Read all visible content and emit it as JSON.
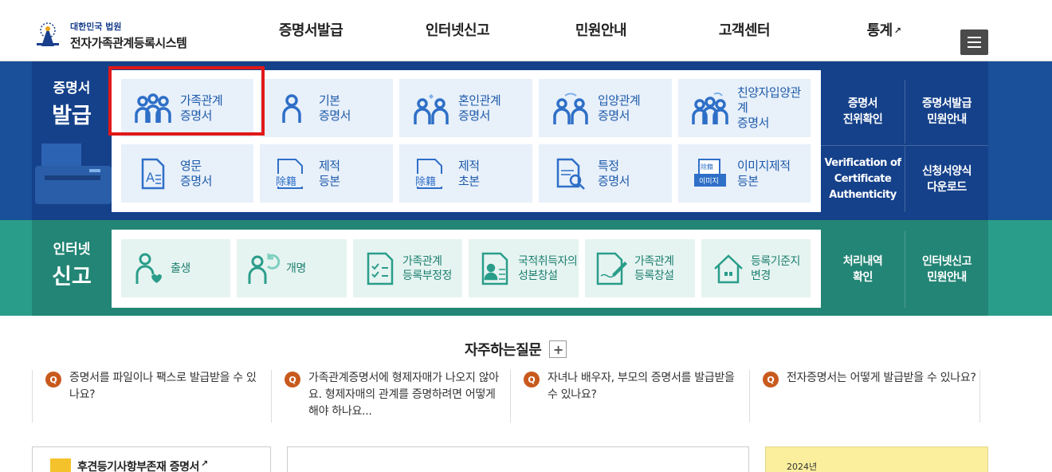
{
  "header": {
    "logo_sub": "대한민국 법원",
    "logo_main": "전자가족관계등록시스템",
    "nav": [
      {
        "label": "증명서발급"
      },
      {
        "label": "인터넷신고"
      },
      {
        "label": "민원안내"
      },
      {
        "label": "고객센터"
      },
      {
        "label": "통계",
        "external": true
      }
    ],
    "menu_icon": "hamburger-icon"
  },
  "issuance": {
    "title_small": "증명서",
    "title_big": "발급",
    "cards": [
      {
        "line1": "가족관계",
        "line2": "증명서",
        "icon": "family-icon"
      },
      {
        "line1": "기본",
        "line2": "증명서",
        "icon": "person-icon"
      },
      {
        "line1": "혼인관계",
        "line2": "증명서",
        "icon": "couple-icon"
      },
      {
        "line1": "입양관계",
        "line2": "증명서",
        "icon": "adoption-icon"
      },
      {
        "line1": "친양자입양관계",
        "line2": "증명서",
        "icon": "adoption-family-icon"
      },
      {
        "line1": "영문",
        "line2": "증명서",
        "icon": "english-doc-icon"
      },
      {
        "line1": "제적",
        "line2": "등본",
        "icon": "removed-doc-icon",
        "stamp": "除籍"
      },
      {
        "line1": "제적",
        "line2": "초본",
        "icon": "removed-doc-icon",
        "stamp": "除籍"
      },
      {
        "line1": "특정",
        "line2": "증명서",
        "icon": "search-doc-icon"
      },
      {
        "line1": "이미지제적",
        "line2": "등본",
        "icon": "image-doc-icon",
        "stamp_top": "除籍",
        "stamp": "이미지"
      }
    ],
    "side": [
      {
        "line1": "증명서",
        "line2": "진위확인"
      },
      {
        "line1": "증명서발급",
        "line2": "민원안내"
      },
      {
        "line1": "Verification of",
        "line2": "Certificate",
        "line3": "Authenticity"
      },
      {
        "line1": "신청서양식",
        "line2": "다운로드"
      }
    ]
  },
  "filing": {
    "title_small": "인터넷",
    "title_big": "신고",
    "cards": [
      {
        "line1": "출생",
        "line2": "",
        "icon": "baby-icon"
      },
      {
        "line1": "개명",
        "line2": "",
        "icon": "rename-icon"
      },
      {
        "line1": "가족관계",
        "line2": "등록부정정",
        "icon": "checklist-icon"
      },
      {
        "line1": "국적취득자의",
        "line2": "성본창설",
        "icon": "id-doc-icon"
      },
      {
        "line1": "가족관계",
        "line2": "등록창설",
        "icon": "write-doc-icon"
      },
      {
        "line1": "등록기준지",
        "line2": "변경",
        "icon": "house-icon"
      }
    ],
    "side": [
      {
        "line1": "처리내역",
        "line2": "확인"
      },
      {
        "line1": "인터넷신고",
        "line2": "민원안내"
      }
    ]
  },
  "faq": {
    "title": "자주하는질문",
    "plus": "+",
    "q_badge": "Q",
    "items": [
      {
        "text": "증명서를 파일이나 팩스로 발급받을 수 있나요?"
      },
      {
        "text": "가족관계증명서에 형제자매가 나오지 않아요. 형제자매의 관계를 증명하려면 어떻게 해야 하나요..."
      },
      {
        "text": "자녀나 배우자, 부모의 증명서를 발급받을 수 있나요?"
      },
      {
        "text": "전자증명서는 어떻게 발급받을 수 있나요?"
      }
    ]
  },
  "bottom": {
    "box1_title": "후견등기사항부존재 증명서",
    "banner_text": "2024년"
  },
  "colors": {
    "issuance_band": "#1a4f9a",
    "filing_band": "#2a9d8a",
    "highlight": "#e01818",
    "faq_badge": "#c85a1e"
  }
}
